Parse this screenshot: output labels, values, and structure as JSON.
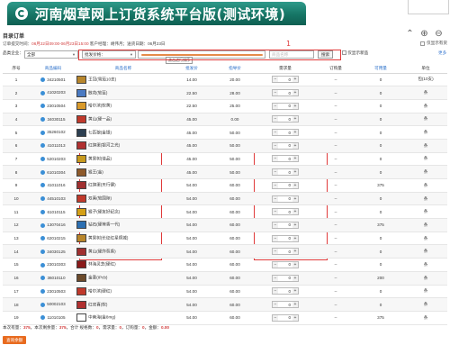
{
  "window": {
    "title": "河南烟草网上订货系统平台版(测试环境)"
  },
  "page": {
    "subtitle": "目录订单"
  },
  "info": {
    "label_time": "订单提交时间：",
    "time": "06月22日09:00-06月23日15:00",
    "manager": "  客户经理：胡伟月；送货日期：06月23日",
    "hide_label": "仅显示有货"
  },
  "filters": {
    "category_label": "品类企业：",
    "category_value": "全部",
    "price_label": "批发价格：",
    "search_placeholder": "商品名称",
    "search_button": "搜索",
    "only_available": "仅显示新品",
    "more": "更多",
    "tooltip": "点击进行排序"
  },
  "annotations": {
    "a1": "1",
    "a2": "2",
    "a3": "3"
  },
  "table": {
    "headers": [
      "序号",
      "商品编码",
      "商品名称",
      "批发价",
      "指导价",
      "需求量",
      "订购量",
      "可用量",
      "单位"
    ],
    "rows": [
      {
        "no": "1",
        "code": "34210501",
        "name": "王冠(雪茄10支)",
        "price": "14.00",
        "guide": "20.00",
        "qty": "0",
        "order": "--",
        "avail": "0",
        "unit": "包(10支)",
        "thumb": "#b8862b"
      },
      {
        "no": "2",
        "code": "41020203",
        "name": "散花(软蓝)",
        "price": "22.50",
        "guide": "28.00",
        "qty": "0",
        "order": "--",
        "avail": "0",
        "unit": "条",
        "thumb": "#4a7ac2"
      },
      {
        "no": "3",
        "code": "23010504",
        "name": "哈尔滨(软黄)",
        "price": "22.50",
        "guide": "25.00",
        "qty": "0",
        "order": "--",
        "avail": "0",
        "unit": "条",
        "thumb": "#d99a2b"
      },
      {
        "no": "4",
        "code": "34030115",
        "name": "黄山(硬一品)",
        "price": "45.00",
        "guide": "0.00",
        "qty": "0",
        "order": "--",
        "avail": "0",
        "unit": "条",
        "thumb": "#c0392b"
      },
      {
        "no": "5",
        "code": "35260102",
        "name": "七匹狼(金银)",
        "price": "45.00",
        "guide": "50.00",
        "qty": "0",
        "order": "--",
        "avail": "0",
        "unit": "条",
        "thumb": "#2c3e50"
      },
      {
        "no": "6",
        "code": "41011013",
        "name": "红旗渠(银河之光)",
        "price": "45.00",
        "guide": "50.00",
        "qty": "0",
        "order": "--",
        "avail": "0",
        "unit": "条",
        "thumb": "#b03030"
      },
      {
        "no": "7",
        "code": "52010203",
        "name": "黄果树(佳品)",
        "price": "45.00",
        "guide": "50.00",
        "qty": "0",
        "order": "--",
        "avail": "0",
        "unit": "条",
        "thumb": "#c79a1e"
      },
      {
        "no": "8",
        "code": "61010304",
        "name": "猴王(金)",
        "price": "45.00",
        "guide": "50.00",
        "qty": "0",
        "order": "--",
        "avail": "0",
        "unit": "条",
        "thumb": "#8e5a2b"
      },
      {
        "no": "9",
        "code": "41011016",
        "name": "红旗渠(天行健)",
        "price": "54.00",
        "guide": "60.00",
        "qty": "0",
        "order": "--",
        "avail": "375",
        "unit": "条",
        "thumb": "#a03030"
      },
      {
        "no": "10",
        "code": "44510103",
        "name": "双喜(软国际)",
        "price": "54.00",
        "guide": "60.00",
        "qty": "0",
        "order": "--",
        "avail": "0",
        "unit": "条",
        "thumb": "#c0392b"
      },
      {
        "no": "11",
        "code": "61010115",
        "name": "猴子(硬友好纪念)",
        "price": "54.00",
        "guide": "60.00",
        "qty": "0",
        "order": "--",
        "avail": "0",
        "unit": "条",
        "thumb": "#d4a017"
      },
      {
        "no": "12",
        "code": "13070416",
        "name": "钻石(硬荷香一代)",
        "price": "54.00",
        "guide": "60.00",
        "qty": "0",
        "order": "--",
        "avail": "375",
        "unit": "条",
        "thumb": "#2c6fb1"
      },
      {
        "no": "13",
        "code": "62010215",
        "name": "黄果树(长征红星炯城)",
        "price": "54.00",
        "guide": "60.00",
        "qty": "0",
        "order": "--",
        "avail": "0",
        "unit": "条",
        "thumb": "#b8862b"
      },
      {
        "no": "14",
        "code": "34030125",
        "name": "黄山(硬炸苞香)",
        "price": "54.00",
        "guide": "60.00",
        "qty": "0",
        "order": "--",
        "avail": "0",
        "unit": "条",
        "thumb": "#a03030"
      },
      {
        "no": "15",
        "code": "23010303",
        "name": "林海灵芝(硬红)",
        "price": "54.00",
        "guide": "60.00",
        "qty": "0",
        "order": "--",
        "avail": "0",
        "unit": "条",
        "thumb": "#8b1a1a"
      },
      {
        "no": "16",
        "code": "36010110",
        "name": "金圣(IPcb)",
        "price": "54.00",
        "guide": "60.00",
        "qty": "0",
        "order": "--",
        "avail": "200",
        "unit": "条",
        "thumb": "#6b4a2b"
      },
      {
        "no": "17",
        "code": "23010503",
        "name": "哈尔滨(硬红)",
        "price": "54.00",
        "guide": "60.00",
        "qty": "0",
        "order": "--",
        "avail": "0",
        "unit": "条",
        "thumb": "#c0392b"
      },
      {
        "no": "18",
        "code": "50002103",
        "name": "红双喜(软)",
        "price": "54.00",
        "guide": "60.00",
        "qty": "0",
        "order": "--",
        "avail": "0",
        "unit": "条",
        "thumb": "#b03030"
      },
      {
        "no": "19",
        "code": "11010105",
        "name": "中南海(金8mg)",
        "price": "54.00",
        "guide": "60.00",
        "qty": "0",
        "order": "--",
        "avail": "375",
        "unit": "条",
        "thumb": "#ffffff"
      }
    ]
  },
  "footer": {
    "text1": "本次有量：",
    "n1": "375",
    "text2": "，本次剩余量：",
    "n2": "375",
    "text3": "，合计 规格数：",
    "n3": "0",
    "text4": "，需求量：",
    "n4": "0",
    "text5": "，订购量：",
    "n5": "0",
    "text6": "，金额：",
    "n6": "0.00",
    "query_button": "查询余额"
  },
  "colors": {
    "title_bg": "#167565",
    "accent": "#3a7ad1",
    "price": "#d23c3c",
    "annotation": "#e03a3a",
    "button": "#e86b1f"
  }
}
